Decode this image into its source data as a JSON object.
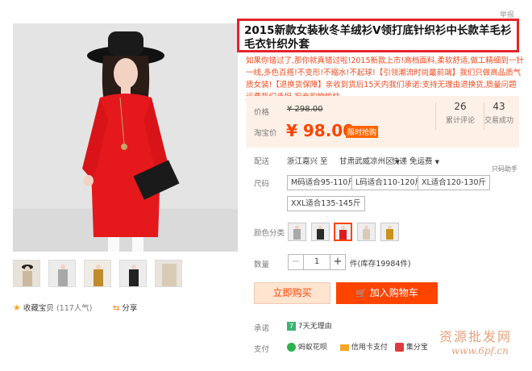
{
  "report_label": "举报",
  "product": {
    "title": "2015新款女装秋冬羊绒衫V领打底针织衫中长款羊毛衫毛衣针织外套",
    "subtitle": "如果你错过了,那你就真错过啦!2015新款上市!高档面料,柔软舒适,做工精细到一针一线,多色百搭!不变形!不缩水!不起球!【引领潮流时尚最前端】我们只做高品质气质女装!【退换货保障】亲收到货后15天内我们承诺:支持无理由退换货,质量问题运费我们承担,祝亲购物愉快"
  },
  "price": {
    "label": "价格",
    "original": "¥ 298.00",
    "tb_label": "淘宝价",
    "current": "¥ 98.00",
    "promo_tag": "限时抢购"
  },
  "stats": {
    "reviews_count": "26",
    "reviews_label": "累计评论",
    "sales_count": "43",
    "sales_label": "交易成功"
  },
  "shipping": {
    "label": "配送",
    "from": "浙江嘉兴 至",
    "to": "甘肃武威凉州区",
    "method": "快递 免运费"
  },
  "size_label": "尺码",
  "size_note": "只码助手",
  "sizes": [
    "M码适合95-110斤",
    "L码适合110-120斤",
    "XL适合120-130斤",
    "XXL适合135-145斤"
  ],
  "color_label": "颜色分类",
  "colors": [
    {
      "name": "grey",
      "fill": "#a9a9a9"
    },
    {
      "name": "black",
      "fill": "#2a2a2a"
    },
    {
      "name": "red",
      "fill": "#d81e1e",
      "selected": true
    },
    {
      "name": "beige",
      "fill": "#d9cbb8"
    },
    {
      "name": "mustard",
      "fill": "#c8921c"
    }
  ],
  "quantity": {
    "label": "数量",
    "value": "1",
    "stock": "件(库存19984件)"
  },
  "actions": {
    "buy_now": "立即购买",
    "add_to_cart": "加入购物车"
  },
  "favorite": {
    "label": "收藏宝贝",
    "count": "(117人气)"
  },
  "share_label": "分享",
  "promise": {
    "label": "承诺",
    "badge": "7",
    "text": "7天无理由"
  },
  "payment": {
    "label": "支付",
    "methods": [
      "蚂蚁花呗",
      "信用卡支付",
      "集分宝"
    ]
  },
  "watermark": {
    "text": "资源批发网",
    "url": "www.6pf.cn"
  },
  "theme": {
    "accent": "#ff4400",
    "highlight_box": "#e5242b"
  }
}
